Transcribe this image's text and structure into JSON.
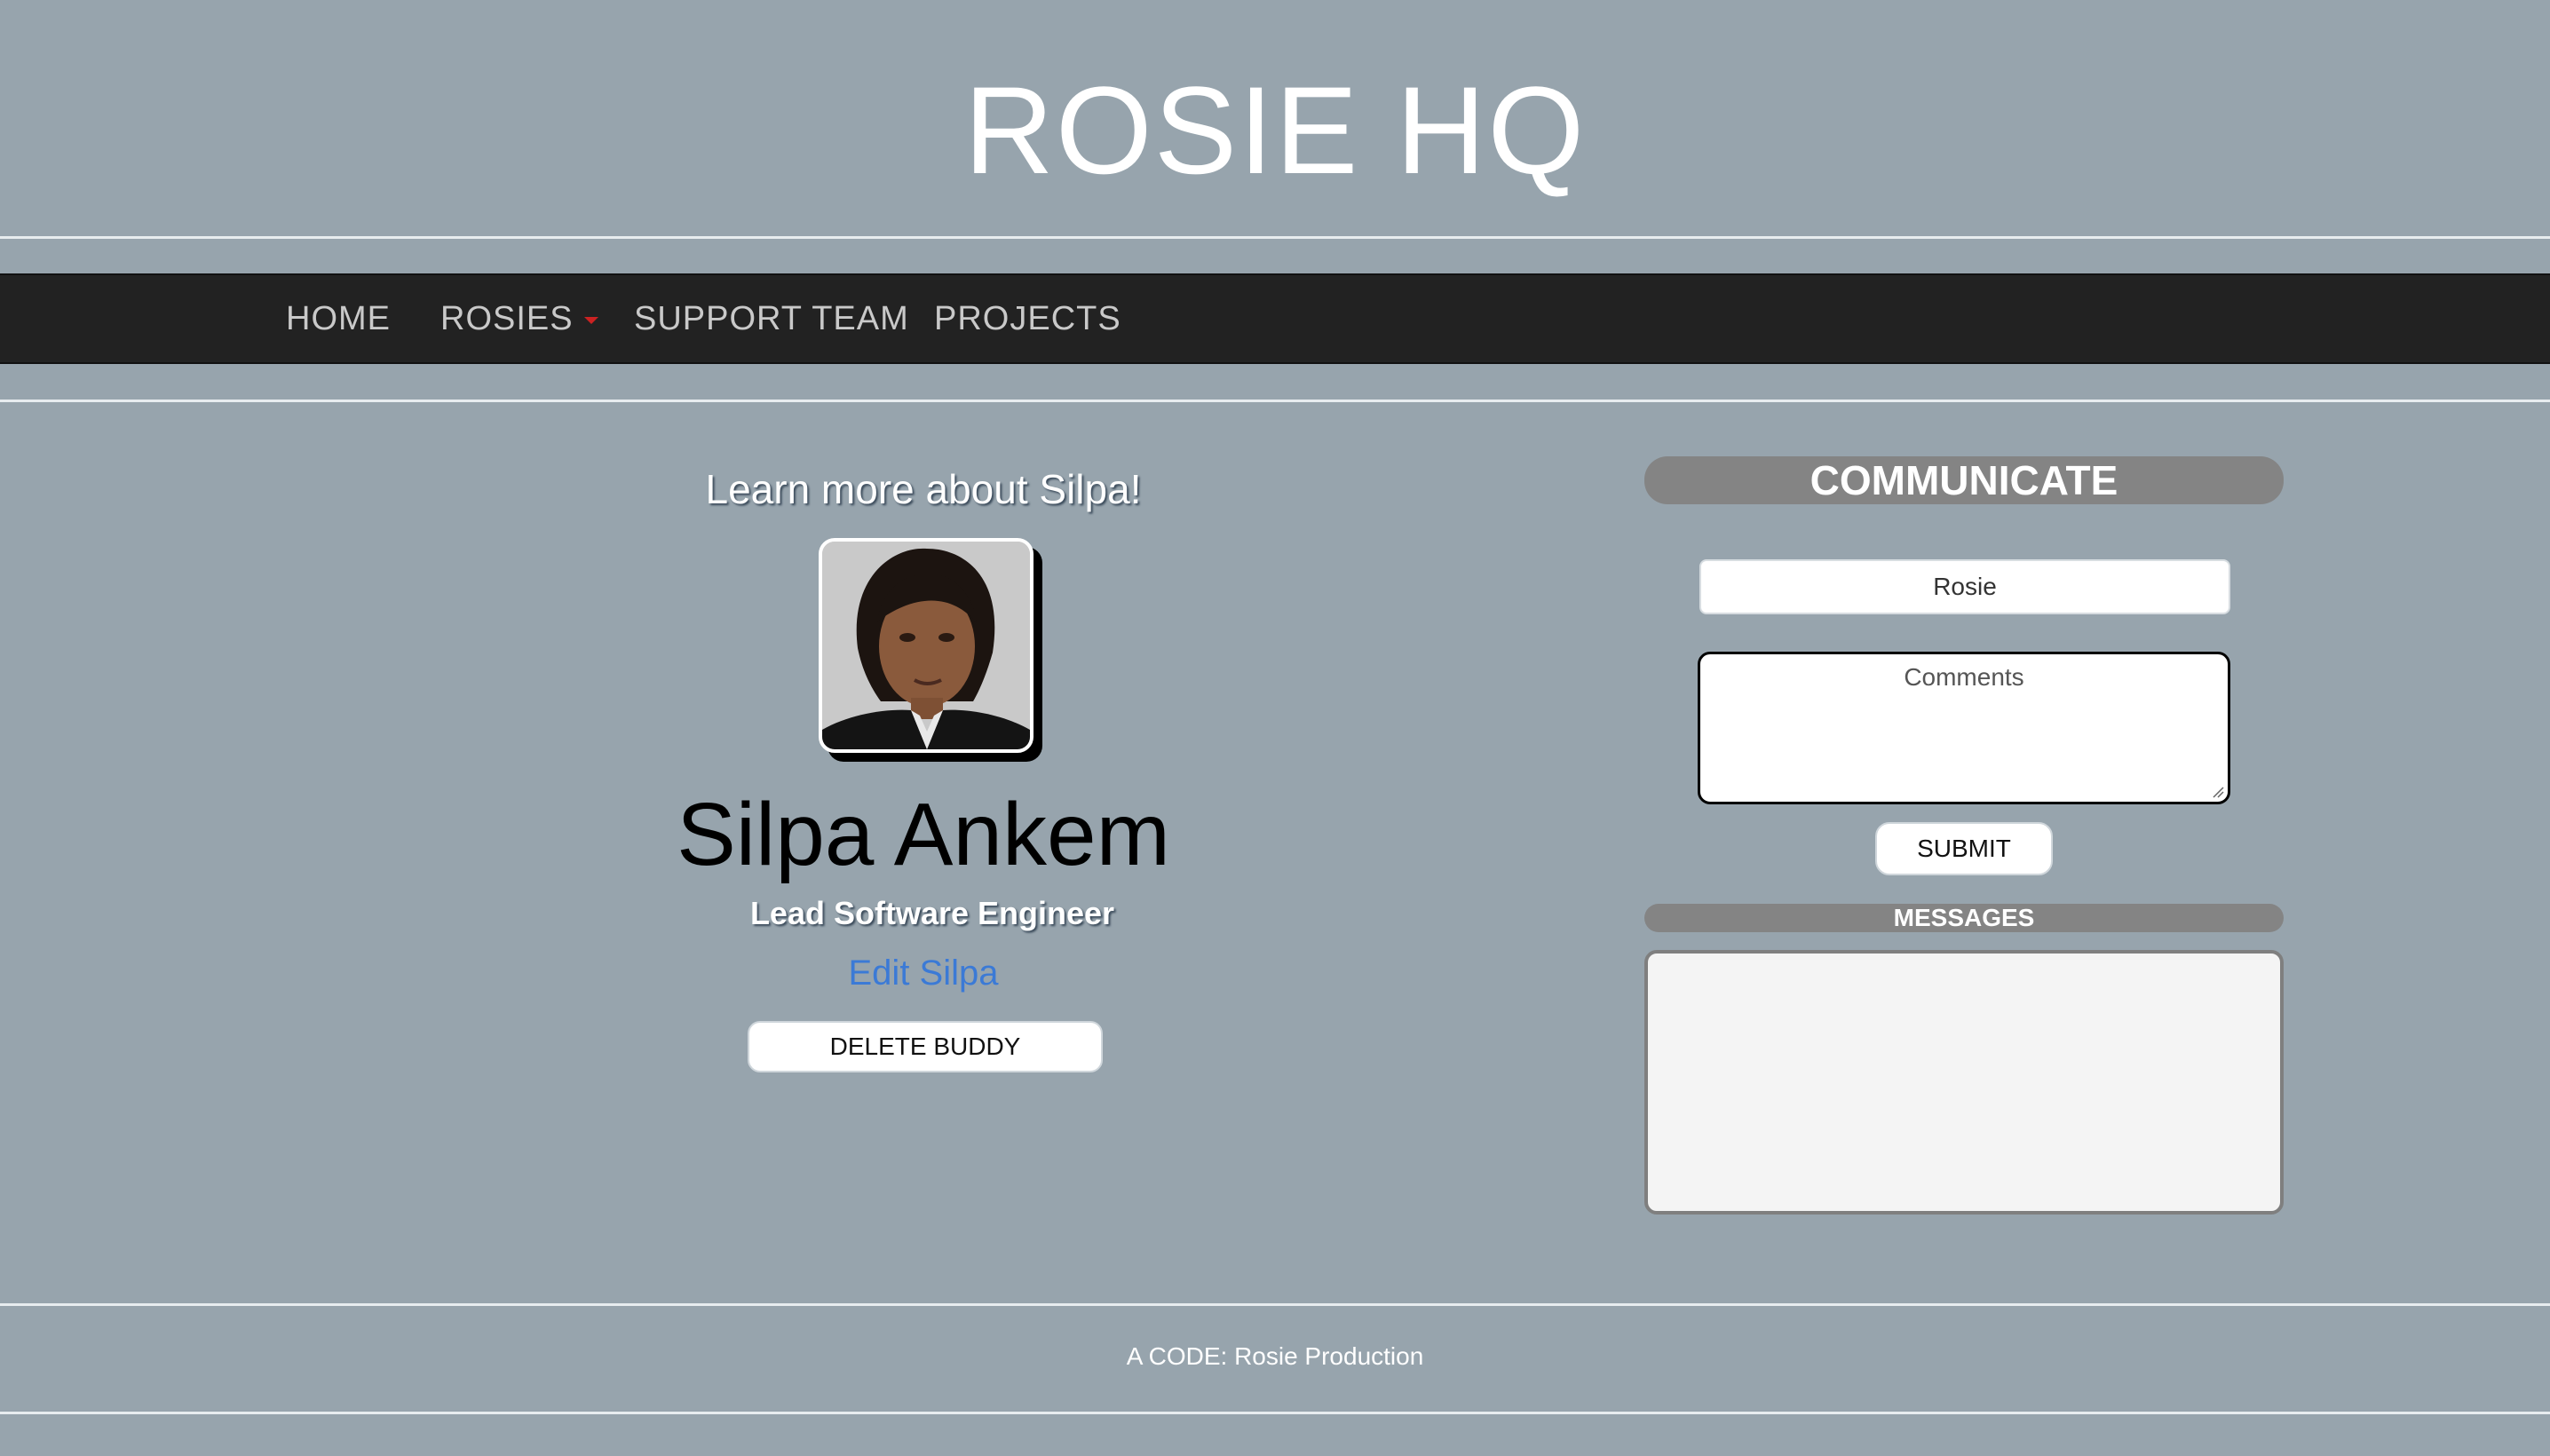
{
  "site": {
    "title": "ROSIE HQ"
  },
  "nav": {
    "items": [
      {
        "label": "HOME"
      },
      {
        "label": "ROSIES"
      },
      {
        "label": "SUPPORT TEAM"
      },
      {
        "label": "PROJECTS"
      }
    ]
  },
  "profile": {
    "heading": "Learn more about Silpa!",
    "name": "Silpa Ankem",
    "role": "Lead Software Engineer",
    "edit_link": "Edit Silpa",
    "delete_button": "DELETE BUDDY"
  },
  "communicate": {
    "header": "COMMUNICATE",
    "name_value": "Rosie",
    "comments_placeholder": "Comments",
    "submit_label": "SUBMIT",
    "messages_header": "MESSAGES"
  },
  "footer": {
    "text": "A CODE: Rosie Production"
  },
  "colors": {
    "background": "#97a4ad",
    "navbar": "#222222",
    "nav_text": "#c9c9c9",
    "caret": "#cc2222",
    "link": "#3b7ad6",
    "pill_header": "#848484"
  }
}
